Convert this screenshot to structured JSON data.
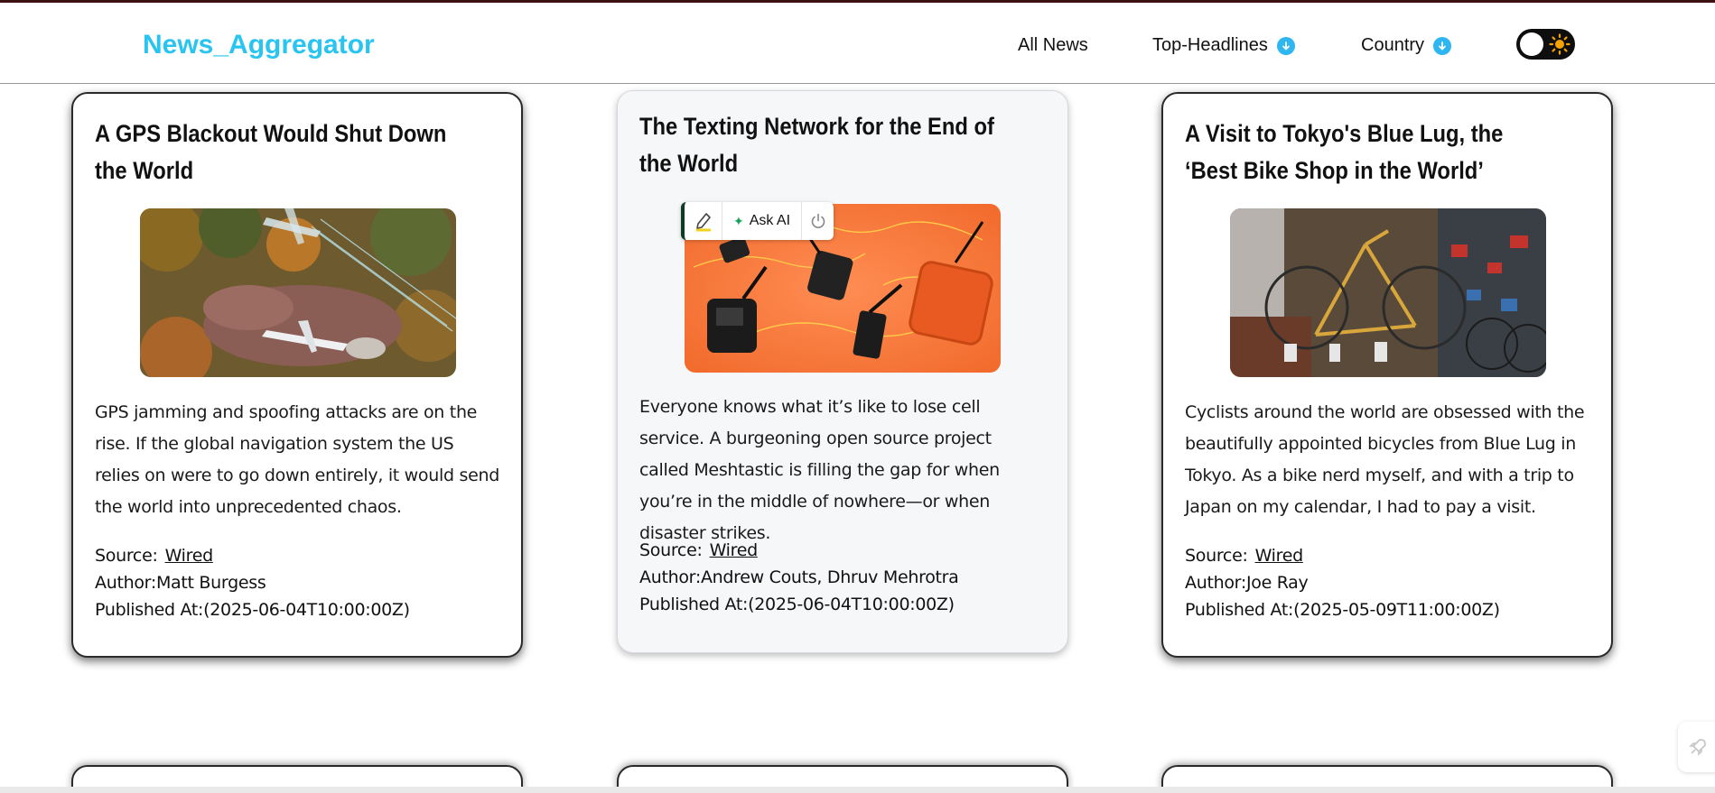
{
  "navbar": {
    "brand": "News_Aggregator",
    "links": [
      {
        "label": "All News"
      },
      {
        "label": "Top-Headlines",
        "icon": "chevron-down-circle-icon"
      },
      {
        "label": "Country",
        "icon": "chevron-down-circle-icon"
      }
    ],
    "theme_toggle": {
      "state": "light",
      "icon": "sun-icon"
    }
  },
  "colors": {
    "brand": "#29c4f0",
    "dropdown_icon": "#2fb6f0",
    "card_border": "#2a2a2a",
    "toggle_bg": "#0e0e0e",
    "sun": "#f5a300"
  },
  "labels": {
    "source": "Source:",
    "author": "Author:",
    "published": "Published At:"
  },
  "articles": [
    {
      "title": "A GPS Blackout Would Shut Down the World",
      "image": "plane-crash-in-forest-image",
      "description": "GPS jamming and spoofing attacks are on the rise. If the global navigation system the US relies on were to go down entirely, it would send the world into unprecedented chaos.",
      "source": "Wired",
      "author": "Matt Burgess",
      "published_at": "(2025-06-04T10:00:00Z)"
    },
    {
      "title": "The Texting Network for the End of the World",
      "image": "radio-devices-on-orange-image",
      "description": "Everyone knows what it’s like to lose cell service. A burgeoning open source project called Meshtastic is filling the gap for when you’re in the middle of nowhere—or when disaster strikes.",
      "source": "Wired",
      "author": "Andrew Couts, Dhruv Mehrotra",
      "published_at": "(2025-06-04T10:00:00Z)"
    },
    {
      "title": "A Visit to Tokyo's Blue Lug, the ‘Best Bike Shop in the World’",
      "image": "bike-shop-interior-image",
      "description": "Cyclists around the world are obsessed with the beautifully appointed bicycles from Blue Lug in Tokyo. As a bike nerd myself, and with a trip to Japan on my calendar, I had to pay a visit.",
      "source": "Wired",
      "author": "Joe Ray",
      "published_at": "(2025-05-09T11:00:00Z)"
    }
  ],
  "ai_toolbar": {
    "ask_label": "Ask AI",
    "icons": [
      "highlighter-icon",
      "sparkle-icon",
      "power-icon"
    ]
  },
  "side_widget": {
    "icon": "rocket-icon"
  }
}
